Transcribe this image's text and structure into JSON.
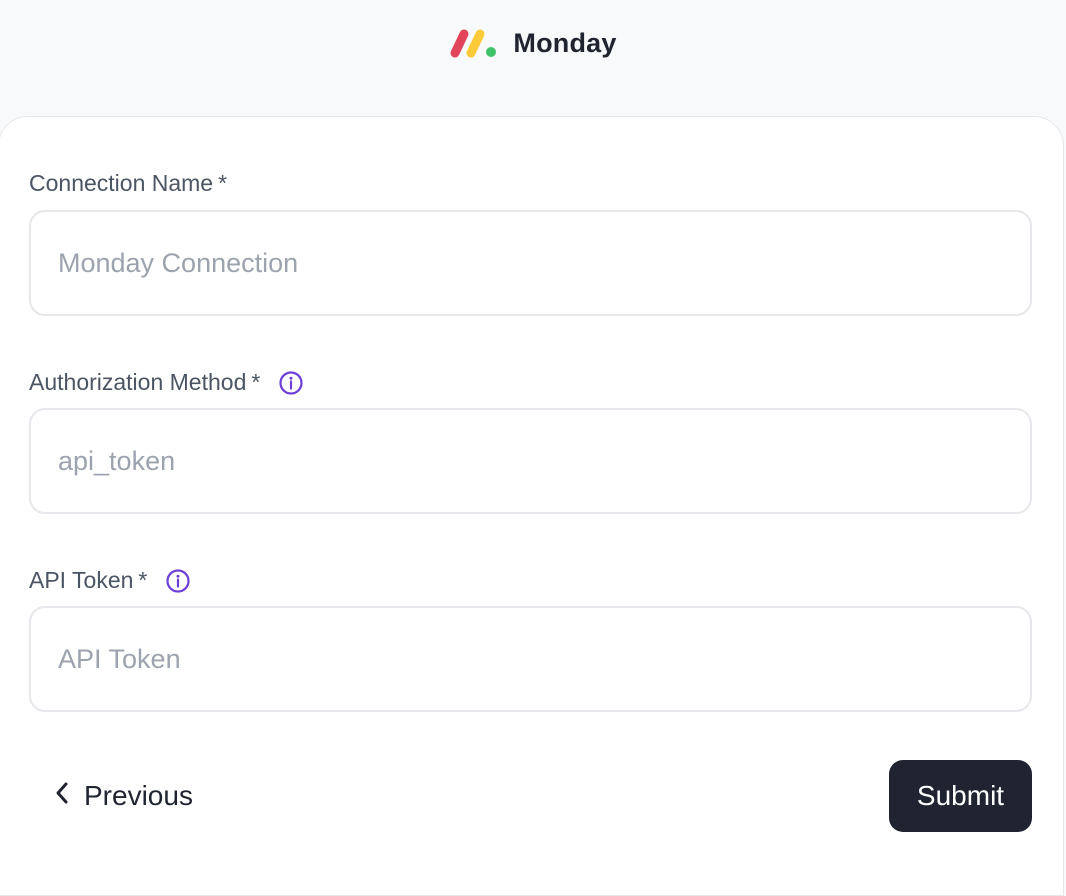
{
  "header": {
    "logo_icon": "monday-logo-icon",
    "app_name": "Monday"
  },
  "form": {
    "fields": [
      {
        "label": "Connection Name",
        "required_mark": "*",
        "value": "",
        "placeholder": "Monday Connection",
        "has_info_icon": false
      },
      {
        "label": "Authorization Method",
        "required_mark": "*",
        "value": "",
        "placeholder": "api_token",
        "has_info_icon": true
      },
      {
        "label": "API Token",
        "required_mark": "*",
        "value": "",
        "placeholder": "API Token",
        "has_info_icon": true
      }
    ]
  },
  "actions": {
    "previous_label": "Previous",
    "submit_label": "Submit"
  },
  "colors": {
    "accent_info": "#6d3fd8",
    "primary_button": "#1f2430",
    "logo_red": "#e2445c",
    "logo_yellow": "#fdcb3a",
    "logo_green": "#3fc26a"
  }
}
